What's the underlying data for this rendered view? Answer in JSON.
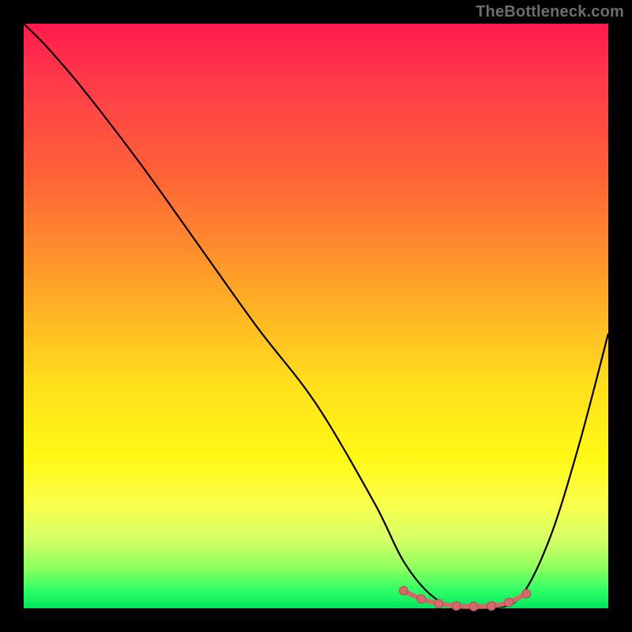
{
  "watermark": "TheBottleneck.com",
  "colors": {
    "frame": "#000000",
    "gradient_top": "#ff1a4d",
    "gradient_bottom": "#00e65e",
    "curve_stroke": "#000000",
    "marker_fill": "#d46a6a",
    "marker_stroke": "#b05050"
  },
  "chart_data": {
    "type": "line",
    "title": "",
    "xlabel": "",
    "ylabel": "",
    "xlim": [
      0,
      100
    ],
    "ylim": [
      0,
      100
    ],
    "annotations": [
      "TheBottleneck.com"
    ],
    "series": [
      {
        "name": "bottleneck-curve",
        "x": [
          0,
          4,
          10,
          20,
          30,
          40,
          50,
          60,
          65,
          70,
          75,
          80,
          85,
          90,
          95,
          100
        ],
        "values": [
          100,
          96,
          89,
          76,
          62,
          48,
          35,
          18,
          8,
          2,
          0,
          0,
          2,
          12,
          28,
          47
        ]
      }
    ],
    "markers": {
      "name": "optimal-range",
      "x": [
        65,
        68,
        71,
        74,
        77,
        80,
        83,
        86
      ],
      "values": [
        3.0,
        1.6,
        0.8,
        0.4,
        0.3,
        0.4,
        1.0,
        2.5
      ]
    }
  }
}
